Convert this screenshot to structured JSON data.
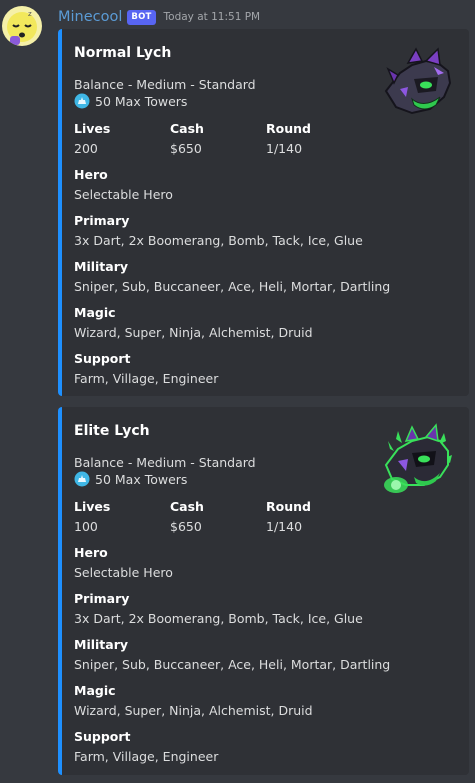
{
  "message": {
    "username": "Minecool",
    "bot_tag": "BOT",
    "timestamp": "Today at 11:51 PM"
  },
  "embeds": [
    {
      "title": "Normal Lych",
      "description": "Balance - Medium - Standard",
      "cap_text": "50 Max Towers",
      "cap_icon": "tower-cap-icon",
      "thumbnail": "lych-boss-icon",
      "accent_color": "#1e90ff",
      "fields": [
        {
          "name": "Lives",
          "value": "200"
        },
        {
          "name": "Cash",
          "value": "$650"
        },
        {
          "name": "Round",
          "value": "1/140"
        },
        {
          "name": "Hero",
          "value": "Selectable Hero"
        },
        {
          "name": "Primary",
          "value": "3x Dart, 2x Boomerang, Bomb, Tack, Ice, Glue"
        },
        {
          "name": "Military",
          "value": "Sniper, Sub, Buccaneer, Ace, Heli, Mortar, Dartling"
        },
        {
          "name": "Magic",
          "value": "Wizard, Super, Ninja, Alchemist, Druid"
        },
        {
          "name": "Support",
          "value": "Farm, Village, Engineer"
        }
      ]
    },
    {
      "title": "Elite Lych",
      "description": "Balance - Medium - Standard",
      "cap_text": "50 Max Towers",
      "cap_icon": "tower-cap-icon",
      "thumbnail": "elite-lych-boss-icon",
      "accent_color": "#1e90ff",
      "fields": [
        {
          "name": "Lives",
          "value": "100"
        },
        {
          "name": "Cash",
          "value": "$650"
        },
        {
          "name": "Round",
          "value": "1/140"
        },
        {
          "name": "Hero",
          "value": "Selectable Hero"
        },
        {
          "name": "Primary",
          "value": "3x Dart, 2x Boomerang, Bomb, Tack, Ice, Glue"
        },
        {
          "name": "Military",
          "value": "Sniper, Sub, Buccaneer, Ace, Heli, Mortar, Dartling"
        },
        {
          "name": "Magic",
          "value": "Wizard, Super, Ninja, Alchemist, Druid"
        },
        {
          "name": "Support",
          "value": "Farm, Village, Engineer"
        }
      ]
    }
  ]
}
